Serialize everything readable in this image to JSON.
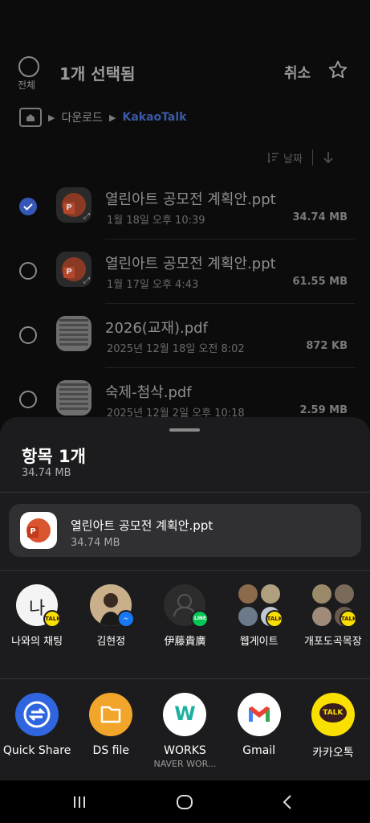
{
  "header": {
    "select_all_label": "전체",
    "title": "1개 선택됨",
    "cancel_label": "취소"
  },
  "breadcrumb": {
    "items": [
      "다운로드",
      "KakaoTalk"
    ]
  },
  "sort": {
    "label": "날짜"
  },
  "files": [
    {
      "name": "열린아트 공모전 계획안.ppt",
      "date": "1월 18일 오후 10:39",
      "size": "34.74 MB",
      "selected": true,
      "type": "ppt"
    },
    {
      "name": "열린아트 공모전 계획안.ppt",
      "date": "1월 17일 오후 4:43",
      "size": "61.55 MB",
      "selected": false,
      "type": "ppt"
    },
    {
      "name": "2026(교재).pdf",
      "date": "2025년 12월 18일 오전 8:02",
      "size": "872 KB",
      "selected": false,
      "type": "pdf"
    },
    {
      "name": "숙제-첨삭.pdf",
      "date": "2025년 12월 2일 오후 10:18",
      "size": "2.59 MB",
      "selected": false,
      "type": "pdf"
    }
  ],
  "sheet": {
    "title": "항목 1개",
    "total_size": "34.74 MB",
    "file_name": "열린아트 공모전 계획안.ppt",
    "file_size": "34.74 MB"
  },
  "contacts": [
    {
      "label": "나와의 채팅",
      "badge": "TALK",
      "badge_color": "#f9e000"
    },
    {
      "label": "김현정",
      "badge": "m",
      "badge_color": "#1877f2"
    },
    {
      "label": "伊藤貴廣",
      "badge": "LINE",
      "badge_color": "#06c755"
    },
    {
      "label": "웹게이트",
      "badge": "TALK",
      "badge_color": "#f9e000"
    },
    {
      "label": "개포도곡목장",
      "badge": "TALK",
      "badge_color": "#f9e000"
    }
  ],
  "apps": [
    {
      "label": "Quick Share",
      "sub": "",
      "color": "#2f66e0"
    },
    {
      "label": "DS file",
      "sub": "",
      "color": "#f2a52b"
    },
    {
      "label": "WORKS",
      "sub": "NAVER WOR...",
      "color": "#ffffff"
    },
    {
      "label": "Gmail",
      "sub": "",
      "color": "#ffffff"
    },
    {
      "label": "카카오톡",
      "sub": "",
      "color": "#f9e000"
    }
  ],
  "talk_badge_text": "TALK",
  "line_badge_text": "LINE",
  "works_icon_text": "W",
  "kakao_icon_text": "TALK",
  "contact_initial": "나"
}
